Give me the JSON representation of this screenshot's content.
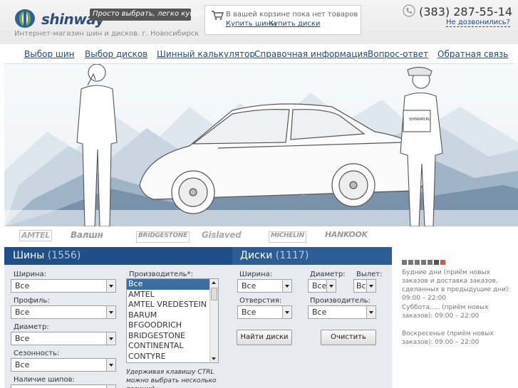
{
  "header": {
    "logo_text": "shinway",
    "slogan": "Просто выбрать, легко купить!!!",
    "subtitle": "Интернет-магазин шин и дисков. г. Новосибирск",
    "cart": {
      "empty_text": "В вашей корзине пока нет товаров",
      "buy_tires": "Купить шины",
      "buy_disks": "Купить диски"
    },
    "phone": "(383) 287-55-14",
    "callback": "Не дозвонились?"
  },
  "nav": [
    "Выбор шин",
    "Выбор дисков",
    "Шинный калькулятор",
    "Справочная информация",
    "Вопрос-ответ",
    "Обратная связь"
  ],
  "banner": {
    "badge_text": "SHINWAY.RU"
  },
  "brands": [
    "AMTEL",
    "Валшн",
    "BRIDGESTONE",
    "Gislaved",
    "MICHELIN",
    "HANKOOK"
  ],
  "tires": {
    "tab_title": "Шины",
    "tab_count": "(1556)",
    "width_label": "Ширина:",
    "width_value": "Все",
    "profile_label": "Профиль:",
    "profile_value": "Все",
    "diameter_label": "Диаметр:",
    "diameter_value": "Все",
    "season_label": "Сезонность:",
    "season_value": "Все",
    "studs_label": "Наличие шипов:",
    "manufacturer_label": "Производитель*:",
    "manufacturers": [
      "Все",
      "AMTEL",
      "AMTEL VREDESTEIN",
      "BARUM",
      "BFGOODRICH",
      "BRIDGESTONE",
      "CONTINENTAL",
      "CONTYRE"
    ],
    "selected_manufacturer": "Все",
    "hint": "Удерживая клавишу CTRL можно выбрать несколько позиций"
  },
  "disks": {
    "tab_title": "Диски",
    "tab_count": "(1117)",
    "width_label": "Ширина:",
    "width_value": "Все",
    "diameter_label": "Диаметр:",
    "diameter_value": "Все",
    "offset_label": "Вылет:",
    "offset_value": "Все",
    "holes_label": "Отверстия:",
    "holes_value": "Все",
    "manufacturer_label": "Производитель:",
    "manufacturer_value": "Все",
    "find_button": "Найти диски",
    "clear_button": "Очистить"
  },
  "schedule": {
    "weekdays": "Будние дни (приём новых заказов и доставка заказов, сделанных в предыдущие дни): 09:00 – 22:00",
    "saturday": "Суббота..... (приём новых заказов): 09:00 – 22:00",
    "sunday": "Воскресенье (приём новых заказов): 09:00 – 22:00"
  },
  "colors": {
    "brand_blue": "#1f4f86",
    "link": "#1a4a8a",
    "panel_bg": "#e7ebef",
    "accent_dot": "#d9534f"
  }
}
